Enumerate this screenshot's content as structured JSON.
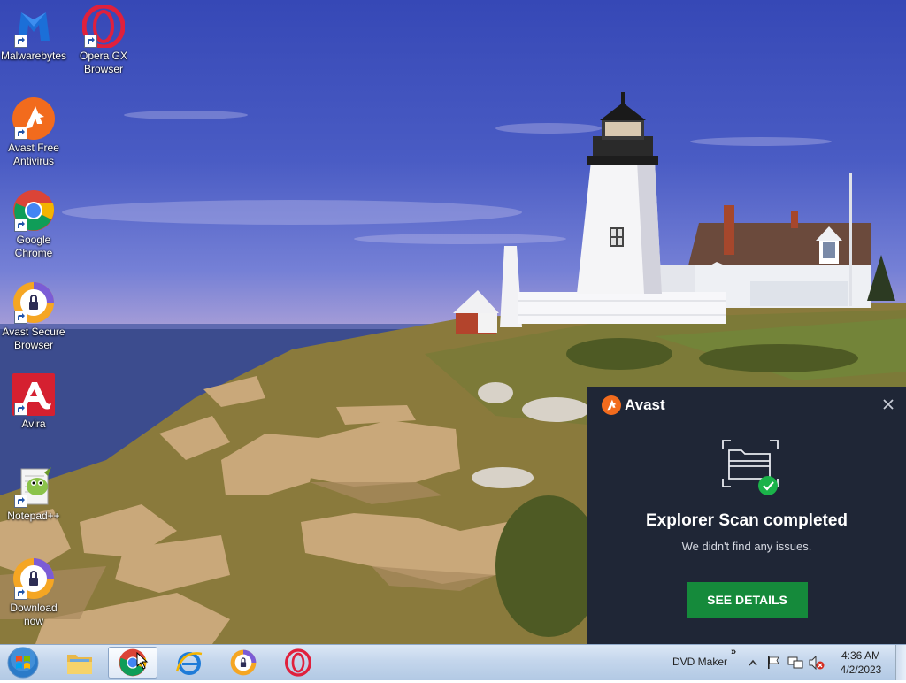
{
  "desktop": {
    "icons": [
      {
        "label": "Malwarebytes",
        "icon": "malwarebytes-icon"
      },
      {
        "label": "Opera GX Browser",
        "icon": "opera-gx-icon"
      },
      {
        "label": "Avast Free Antivirus",
        "icon": "avast-icon"
      },
      {
        "label": "Google Chrome",
        "icon": "chrome-icon"
      },
      {
        "label": "Avast Secure Browser",
        "icon": "avast-secure-browser-icon"
      },
      {
        "label": "Avira",
        "icon": "avira-icon"
      },
      {
        "label": "Notepad++",
        "icon": "notepad-plus-plus-icon"
      },
      {
        "label": "Download now",
        "icon": "avast-secure-browser-icon"
      }
    ]
  },
  "popup": {
    "brand": "Avast",
    "title": "Explorer Scan completed",
    "subtitle": "We didn't find any issues.",
    "button_label": "SEE DETAILS",
    "accent_color": "#158a3b",
    "background_color": "#1f2636"
  },
  "taskbar": {
    "pinned": [
      "windows-explorer-icon",
      "chrome-icon",
      "internet-explorer-icon",
      "avast-secure-browser-icon",
      "opera-icon"
    ],
    "toolbar_label": "DVD Maker",
    "clock_time": "4:36 AM",
    "clock_date": "4/2/2023"
  }
}
